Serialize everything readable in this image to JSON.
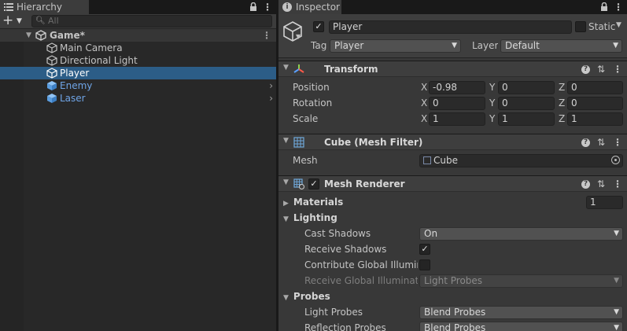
{
  "hierarchy": {
    "tab_title": "Hierarchy",
    "search_placeholder": "All",
    "scene_name": "Game*",
    "items": [
      {
        "label": "Main Camera",
        "prefab": false
      },
      {
        "label": "Directional Light",
        "prefab": false
      },
      {
        "label": "Player",
        "prefab": false,
        "selected": true
      },
      {
        "label": "Enemy",
        "prefab": true
      },
      {
        "label": "Laser",
        "prefab": true
      }
    ],
    "selection_color": "#2c5d87",
    "prefab_color": "#6fa4e6"
  },
  "inspector": {
    "tab_title": "Inspector",
    "object_name": "Player",
    "static_label": "Static",
    "tag_label": "Tag",
    "tag_value": "Player",
    "layer_label": "Layer",
    "layer_value": "Default",
    "transform": {
      "title": "Transform",
      "position_label": "Position",
      "rotation_label": "Rotation",
      "scale_label": "Scale",
      "axis_x": "X",
      "axis_y": "Y",
      "axis_z": "Z",
      "position": [
        "-0.98",
        "0",
        "0"
      ],
      "rotation": [
        "0",
        "0",
        "0"
      ],
      "scale": [
        "1",
        "1",
        "1"
      ]
    },
    "mesh_filter": {
      "title": "Cube (Mesh Filter)",
      "mesh_label": "Mesh",
      "mesh_value": "Cube"
    },
    "mesh_renderer": {
      "title": "Mesh Renderer",
      "materials_label": "Materials",
      "materials_count": "1",
      "lighting_label": "Lighting",
      "cast_shadows_label": "Cast Shadows",
      "cast_shadows_value": "On",
      "receive_shadows_label": "Receive Shadows",
      "contribute_gi_label": "Contribute Global Illumina",
      "receive_gi_label": "Receive Global Illuminatio",
      "receive_gi_value": "Light Probes",
      "probes_label": "Probes",
      "light_probes_label": "Light Probes",
      "light_probes_value": "Blend Probes",
      "reflection_probes_label": "Reflection Probes",
      "reflection_probes_value": "Blend Probes"
    }
  }
}
